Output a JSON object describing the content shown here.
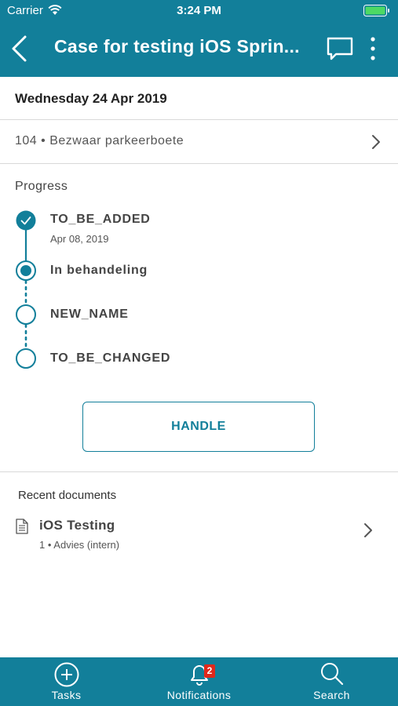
{
  "status_bar": {
    "carrier": "Carrier",
    "time": "3:24 PM"
  },
  "nav": {
    "title": "Case for testing iOS Sprin..."
  },
  "date": "Wednesday 24 Apr 2019",
  "case": {
    "label": "104 • Bezwaar parkeerboete"
  },
  "progress": {
    "heading": "Progress",
    "steps": [
      {
        "label": "TO_BE_ADDED",
        "date": "Apr 08, 2019",
        "state": "done"
      },
      {
        "label": "In behandeling",
        "state": "current"
      },
      {
        "label": "NEW_NAME",
        "state": "pending"
      },
      {
        "label": "TO_BE_CHANGED",
        "state": "pending"
      }
    ]
  },
  "handle_button": "HANDLE",
  "recent_documents": {
    "heading": "Recent documents",
    "items": [
      {
        "title": "iOS Testing",
        "subtitle": "1 • Advies (intern)"
      }
    ]
  },
  "tabbar": {
    "tabs": [
      {
        "label": "Tasks",
        "icon": "plus-circle-icon"
      },
      {
        "label": "Notifications",
        "icon": "bell-icon",
        "badge": "2"
      },
      {
        "label": "Search",
        "icon": "search-icon"
      }
    ]
  },
  "colors": {
    "accent": "#127f9a",
    "badge": "#e0281b"
  }
}
